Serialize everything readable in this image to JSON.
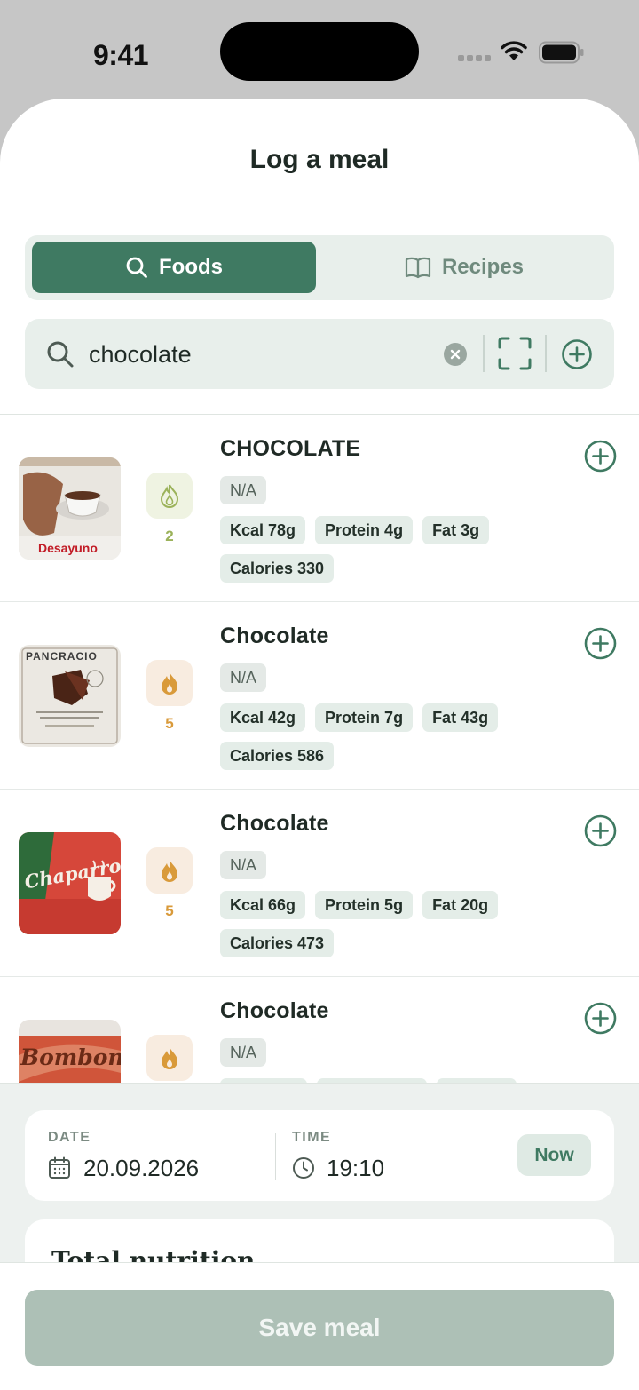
{
  "status_bar": {
    "time": "9:41"
  },
  "sheet": {
    "title": "Log a meal"
  },
  "tabs": {
    "foods": "Foods",
    "recipes": "Recipes",
    "active": "foods"
  },
  "search": {
    "value": "chocolate",
    "placeholder": ""
  },
  "results": [
    {
      "name": "CHOCOLATE",
      "score": "2",
      "score_level": "low",
      "brand": "N/A",
      "chips": [
        "Kcal 78g",
        "Protein 4g",
        "Fat 3g",
        "Calories 330"
      ],
      "thumb_text": "Desayuno"
    },
    {
      "name": "Chocolate",
      "score": "5",
      "score_level": "high",
      "brand": "N/A",
      "chips": [
        "Kcal 42g",
        "Protein 7g",
        "Fat 43g",
        "Calories 586"
      ],
      "thumb_text": "PANCRACIO"
    },
    {
      "name": "Chocolate",
      "score": "5",
      "score_level": "high",
      "brand": "N/A",
      "chips": [
        "Kcal 66g",
        "Protein 5g",
        "Fat 20g",
        "Calories 473"
      ],
      "thumb_text": "Chaparro"
    },
    {
      "name": "Chocolate",
      "score": "",
      "score_level": "high",
      "brand": "N/A",
      "chips": [],
      "thumb_text": "Bombon"
    }
  ],
  "datetime": {
    "date_label": "DATE",
    "date_value": "20.09.2026",
    "time_label": "TIME",
    "time_value": "19:10",
    "now_label": "Now"
  },
  "nutrition": {
    "title": "Total nutrition"
  },
  "footer": {
    "save_label": "Save meal"
  },
  "colors": {
    "accent": "#3f7a62",
    "score_low": "#9bb25a",
    "score_high": "#d99a3a",
    "save_disabled": "#adc0b6"
  }
}
